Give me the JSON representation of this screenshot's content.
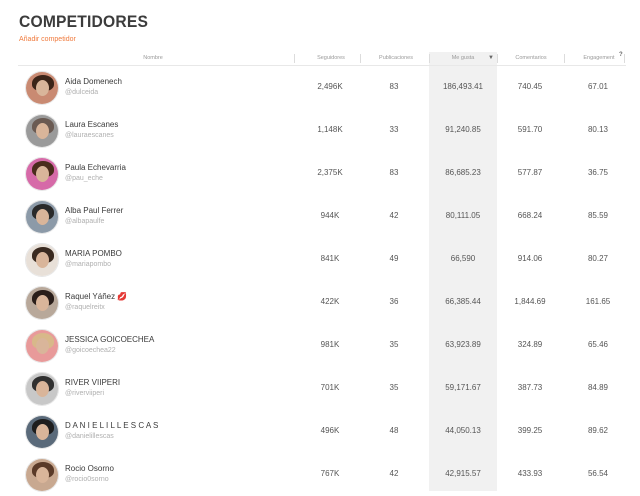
{
  "page": {
    "title": "COMPETIDORES",
    "add_link": "Añadir competidor"
  },
  "columns": {
    "name": "Nombre",
    "followers": "Seguidores",
    "posts": "Publicaciones",
    "likes": "Me gusta",
    "comments": "Comentarios",
    "engagement": "Engagement"
  },
  "sort_icon": "sort-down-icon",
  "info_icon": "question-icon",
  "rows": [
    {
      "name": "Aida Domenech",
      "handle": "@dulceida",
      "followers": "2,496K",
      "posts": "83",
      "likes": "186,493.41",
      "comments": "740.45",
      "engagement": "67.01",
      "hair": "#3b2418",
      "bg": "#c98a72"
    },
    {
      "name": "Laura Escanes",
      "handle": "@lauraescanes",
      "followers": "1,148K",
      "posts": "33",
      "likes": "91,240.85",
      "comments": "591.70",
      "engagement": "80.13",
      "hair": "#6a5a52",
      "bg": "#9a9a9a"
    },
    {
      "name": "Paula Echevarria",
      "handle": "@pau_eche",
      "followers": "2,375K",
      "posts": "83",
      "likes": "86,685.23",
      "comments": "577.87",
      "engagement": "36.75",
      "hair": "#4a2c1c",
      "bg": "#d66aa8"
    },
    {
      "name": "Alba Paul Ferrer",
      "handle": "@albapaulfe",
      "followers": "944K",
      "posts": "42",
      "likes": "80,111.05",
      "comments": "668.24",
      "engagement": "85.59",
      "hair": "#2a2a2a",
      "bg": "#8c9aa8"
    },
    {
      "name": "MARIA POMBO",
      "handle": "@mariapombo",
      "followers": "841K",
      "posts": "49",
      "likes": "66,590",
      "comments": "914.06",
      "engagement": "80.27",
      "hair": "#3a2a20",
      "bg": "#e8e0d8"
    },
    {
      "name": "Raquel Yáñez",
      "handle": "@raquelreitx",
      "followers": "422K",
      "posts": "36",
      "likes": "66,385.44",
      "comments": "1,844.69",
      "engagement": "161.65",
      "hair": "#2a1e1a",
      "bg": "#b8a89a"
    },
    {
      "name": "JESSICA GOICOECHEA",
      "handle": "@goicoechea22",
      "followers": "981K",
      "posts": "35",
      "likes": "63,923.89",
      "comments": "324.89",
      "engagement": "65.46",
      "hair": "#d8b88a",
      "bg": "#e89a9a"
    },
    {
      "name": "RIVER VIIPERI",
      "handle": "@riverviiperi",
      "followers": "701K",
      "posts": "35",
      "likes": "59,171.67",
      "comments": "387.73",
      "engagement": "84.89",
      "hair": "#303030",
      "bg": "#c8c8c8"
    },
    {
      "name": "D A N I E L I L L E S C A S",
      "handle": "@danielillescas",
      "followers": "496K",
      "posts": "48",
      "likes": "44,050.13",
      "comments": "399.25",
      "engagement": "89.62",
      "hair": "#1e1e1e",
      "bg": "#5a6a7a"
    },
    {
      "name": "Rocio Osorno",
      "handle": "@rocio0sorno",
      "followers": "767K",
      "posts": "42",
      "likes": "42,915.57",
      "comments": "433.93",
      "engagement": "56.54",
      "hair": "#5a3a28",
      "bg": "#c8a890"
    }
  ]
}
